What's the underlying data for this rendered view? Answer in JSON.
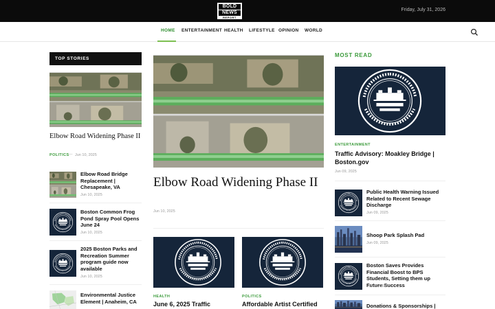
{
  "header": {
    "logo": {
      "line1": "BOLD",
      "line2": "NEWS",
      "line3": "REPORT"
    },
    "date": "Friday, July 31, 2026"
  },
  "nav": {
    "items": [
      {
        "label": "HOME",
        "active": true
      },
      {
        "label": "ENTERTAINMENT"
      },
      {
        "label": "HEALTH"
      },
      {
        "label": "LIFESTYLE"
      },
      {
        "label": "OPINION"
      },
      {
        "label": "WORLD"
      }
    ],
    "search_icon": "search-icon"
  },
  "top_stories": {
    "heading": "TOP STORIES",
    "lead": {
      "title": "Elbow Road Widening Phase II",
      "category": "POLITICS",
      "date": "Jun 10, 2025"
    },
    "items": [
      {
        "title": "Elbow Road Bridge Replacement | Chesapeake, VA",
        "date": "Jun 10, 2025",
        "thumb": "aerial"
      },
      {
        "title": "Boston Common Frog Pond Spray Pool Opens June 24",
        "date": "Jun 10, 2025",
        "thumb": "seal"
      },
      {
        "title": "2025 Boston Parks and Recreation Summer program guide now available",
        "date": "Jun 10, 2025",
        "thumb": "seal"
      },
      {
        "title": "Environmental Justice Element | Anaheim, CA",
        "date": "",
        "thumb": "map"
      }
    ]
  },
  "feature": {
    "title": "Elbow Road Widening Phase II",
    "date": "Jun 10, 2025"
  },
  "grid": [
    {
      "category": "HEALTH",
      "title": "June 6, 2025 Traffic"
    },
    {
      "category": "POLITICS",
      "title": "Affordable Artist Certified"
    }
  ],
  "most_read": {
    "heading": "MOST READ",
    "lead": {
      "category": "ENTERTAINMENT",
      "title": "Traffic Advisory: Moakley Bridge | Boston.gov",
      "date": "Jun 09, 2025"
    },
    "items": [
      {
        "title": "Public Health Warning Issued Related to Recent Sewage Discharge",
        "date": "Jun 09, 2025",
        "thumb": "seal"
      },
      {
        "title": "Shoop Park Splash Pad",
        "date": "Jun 09, 2025",
        "thumb": "city"
      },
      {
        "title": "Boston Saves Provides Financial Boost to BPS Students, Setting them up Future Success",
        "date": "Jun 09, 2025",
        "thumb": "seal"
      },
      {
        "title": "Donations & Sponsorships |",
        "date": "",
        "thumb": "city"
      }
    ]
  },
  "seal": {
    "ring_top": "SICUT PATRIBUS SIT DEUS NOBIS",
    "ring_bottom": "CIVITATIS REGIMINE DONATA A.D. 1822",
    "name": "BOSTONIA",
    "condita": "CONDITA AD",
    "year": "1630"
  },
  "colors": {
    "accent": "#3a9a3a",
    "topbar": "#0b0b0b",
    "seal_bg": "#15253a"
  }
}
